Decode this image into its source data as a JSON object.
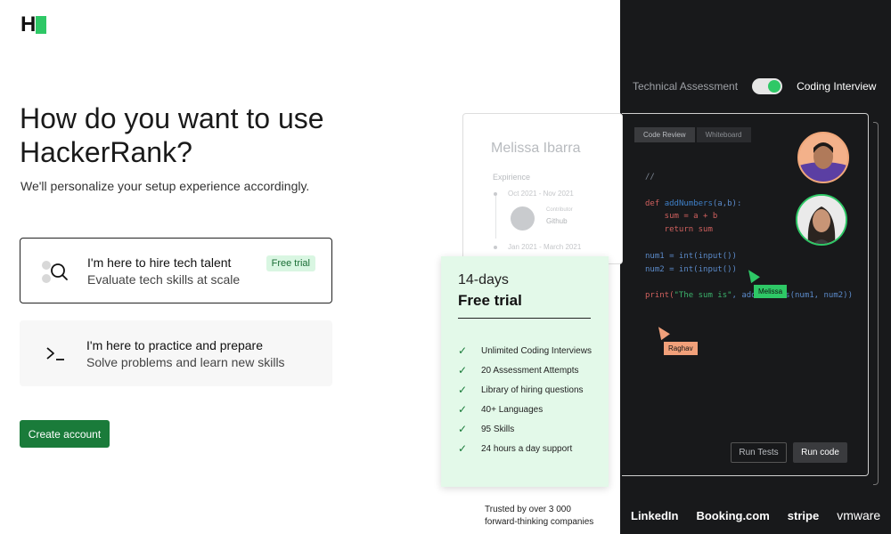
{
  "brand": {
    "logo_letter": "H",
    "accent": "#2ec866"
  },
  "headline": "How do you want to use HackerRank?",
  "subhead": "We'll personalize your setup experience accordingly.",
  "options": [
    {
      "title": "I'm here to hire tech talent",
      "desc": "Evaluate tech skills at scale",
      "badge": "Free trial",
      "icon": "search-icon",
      "selected": true
    },
    {
      "title": "I'm here to practice and prepare",
      "desc": "Solve problems and learn new skills",
      "icon": "terminal-icon",
      "selected": false
    }
  ],
  "create_button": "Create account",
  "toggle": {
    "left_label": "Technical Assessment",
    "right_label": "Coding Interview",
    "state": "Coding Interview"
  },
  "profile": {
    "name": "Melissa Ibarra",
    "section": "Expirience",
    "date1": "Oct 2021 - Nov 2021",
    "contrib": "Contributor",
    "company": "Github",
    "date2": "Jan 2021 - March 2021"
  },
  "code_tabs": [
    "Code Review",
    "Whiteboard"
  ],
  "code_lines": {
    "l1": "//",
    "l2_kw": "def ",
    "l2_fn": "addNumbers",
    "l2_rest": "(a,b):",
    "l3": "    sum = a + b",
    "l4_kw": "    return ",
    "l4_rest": "sum",
    "l5": "num1 = int(input())",
    "l6": "num2 = int(input())",
    "l7_kw": "print(",
    "l7_str": "\"The sum is\"",
    "l7_rest": ", addNumbers(num1, num2))"
  },
  "cursors": {
    "melissa": "Melissa",
    "raghav": "Raghav"
  },
  "code_buttons": {
    "tests": "Run Tests",
    "run": "Run code"
  },
  "trial": {
    "days": "14-days",
    "title": "Free trial",
    "features": [
      "Unlimited Coding Interviews",
      "20 Assessment Attempts",
      "Library of hiring questions",
      "40+ Languages",
      "95 Skills",
      "24 hours a day support"
    ]
  },
  "trusted": {
    "line1": "Trusted by over 3 000",
    "line2": "forward-thinking companies"
  },
  "partner_logos": [
    "LinkedIn",
    "Booking.com",
    "stripe",
    "vmware"
  ]
}
